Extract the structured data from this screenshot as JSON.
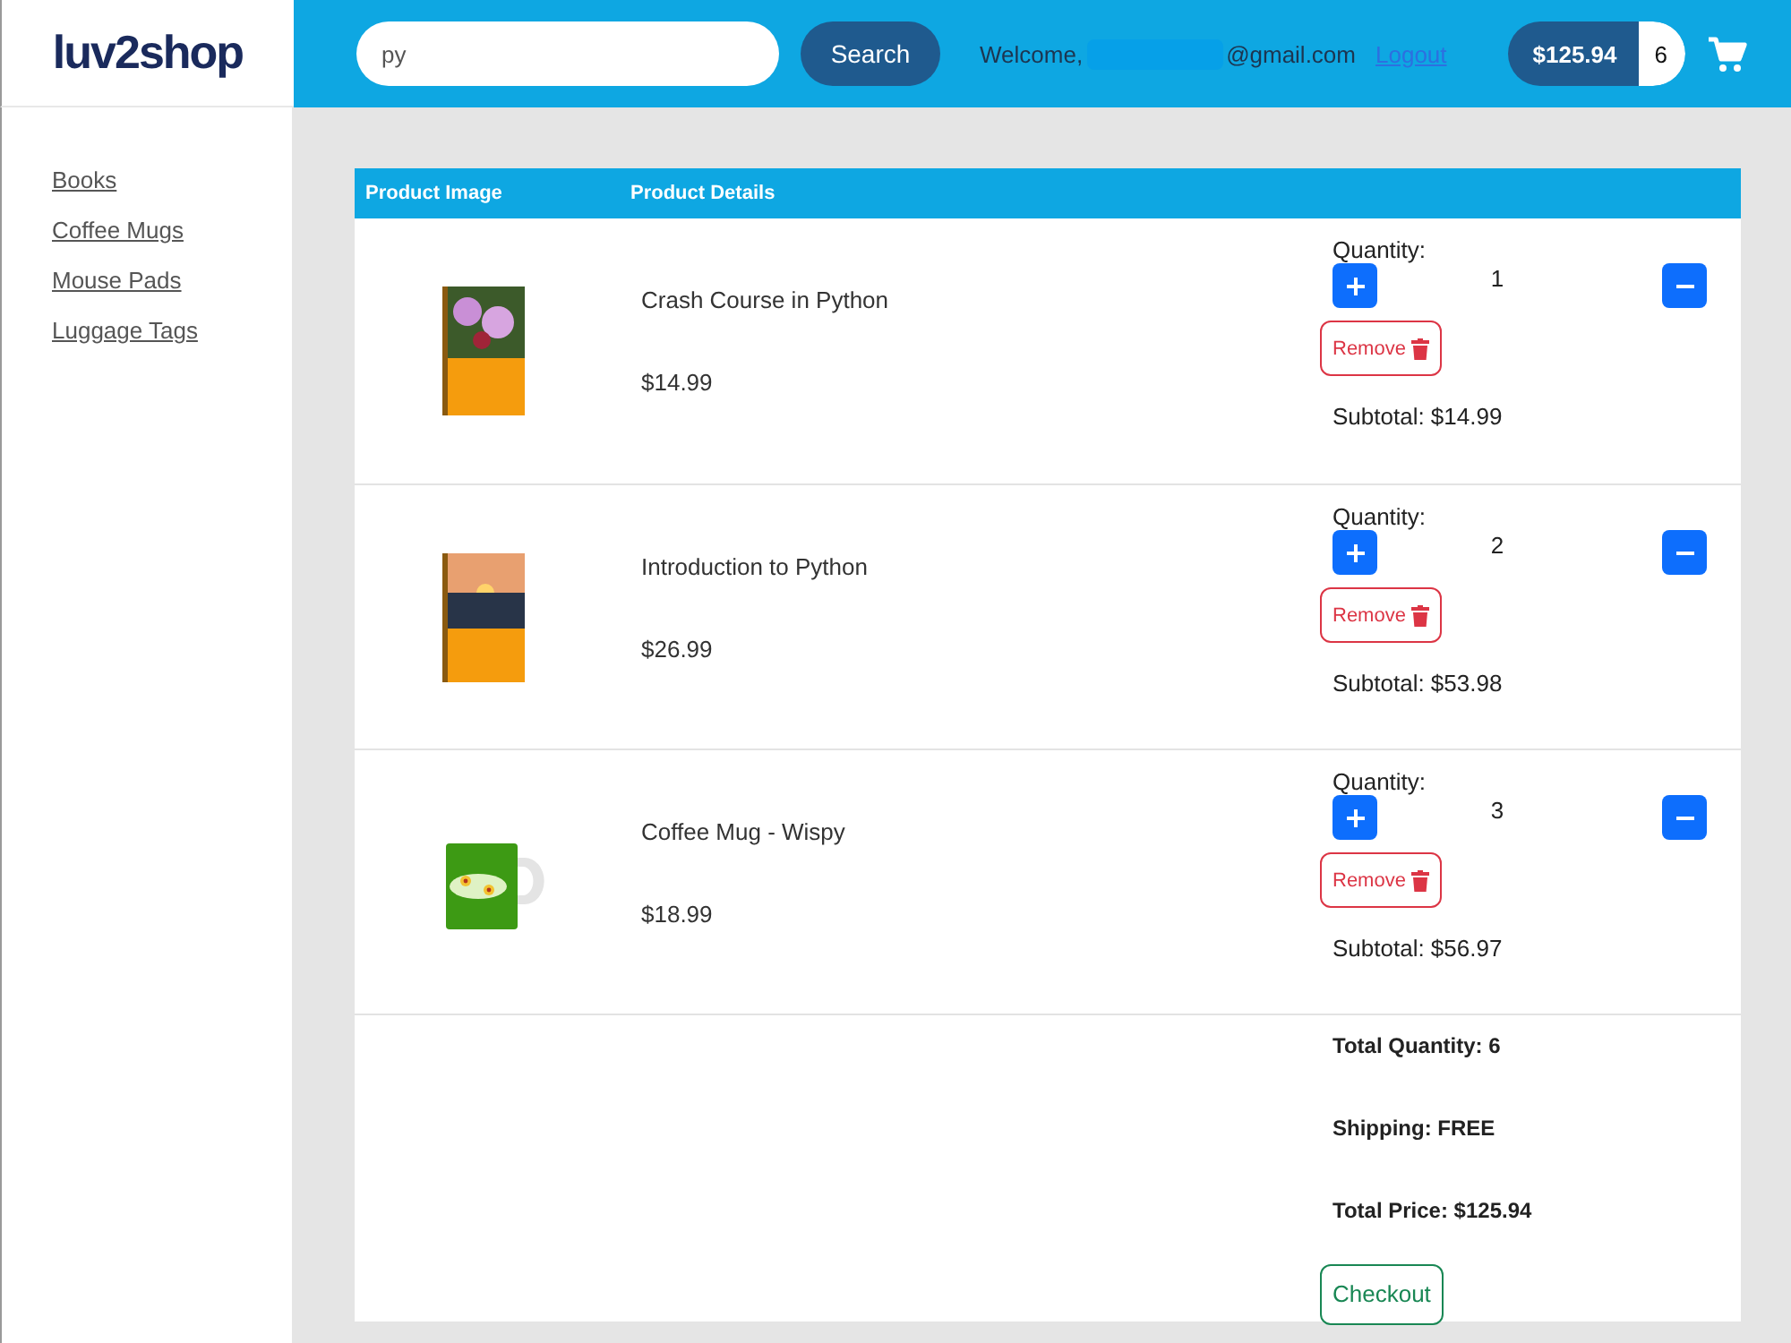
{
  "header": {
    "logo": "luv2shop",
    "search": {
      "value": "py",
      "button": "Search"
    },
    "welcome": "Welcome,",
    "email": "@gmail.com",
    "logout": "Logout",
    "cart_total": "$125.94",
    "cart_count": "6"
  },
  "sidebar": {
    "items": [
      {
        "label": "Books"
      },
      {
        "label": "Coffee Mugs"
      },
      {
        "label": "Mouse Pads"
      },
      {
        "label": "Luggage Tags"
      }
    ]
  },
  "table": {
    "columns": [
      "Product Image",
      "Product Details"
    ],
    "rows": [
      {
        "name": "Crash Course in Python",
        "price": "$14.99",
        "quantity_label": "Quantity:",
        "quantity": "1",
        "remove": "Remove",
        "subtotal": "Subtotal: $14.99"
      },
      {
        "name": "Introduction to Python",
        "price": "$26.99",
        "quantity_label": "Quantity:",
        "quantity": "2",
        "remove": "Remove",
        "subtotal": "Subtotal: $53.98"
      },
      {
        "name": "Coffee Mug - Wispy",
        "price": "$18.99",
        "quantity_label": "Quantity:",
        "quantity": "3",
        "remove": "Remove",
        "subtotal": "Subtotal: $56.97"
      }
    ],
    "summary": {
      "total_quantity": "Total Quantity: 6",
      "shipping": "Shipping: FREE",
      "total_price": "Total Price: $125.94",
      "checkout": "Checkout"
    }
  }
}
